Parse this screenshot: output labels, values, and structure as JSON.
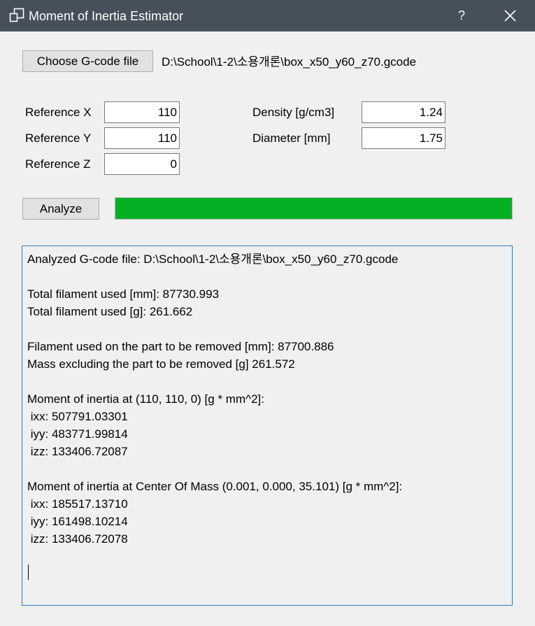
{
  "window": {
    "title": "Moment of Inertia Estimator",
    "help_label": "?",
    "icons": {
      "app": "window-icon",
      "close": "close-icon"
    }
  },
  "file": {
    "choose_label": "Choose G-code file",
    "path": "D:\\School\\1-2\\소용개론\\box_x50_y60_z70.gcode"
  },
  "params": {
    "ref_x": {
      "label": "Reference X",
      "value": "110"
    },
    "ref_y": {
      "label": "Reference Y",
      "value": "110"
    },
    "ref_z": {
      "label": "Reference Z",
      "value": "0"
    },
    "density": {
      "label": "Density [g/cm3]",
      "value": "1.24"
    },
    "diameter": {
      "label": "Diameter [mm]",
      "value": "1.75"
    }
  },
  "analyze": {
    "button_label": "Analyze",
    "progress": 1.0,
    "progress_color": "#06b025"
  },
  "output": {
    "lines": [
      "Analyzed G-code file: D:\\School\\1-2\\소용개론\\box_x50_y60_z70.gcode",
      "",
      "Total filament used [mm]: 87730.993",
      "Total filament used [g]: 261.662",
      "",
      "Filament used on the part to be removed [mm]: 87700.886",
      "Mass excluding the part to be removed [g] 261.572",
      "",
      "Moment of inertia at (110, 110, 0) [g * mm^2]:",
      " ixx: 507791.03301",
      " iyy: 483771.99814",
      " izz: 133406.72087",
      "",
      "Moment of inertia at Center Of Mass (0.001, 0.000, 35.101) [g * mm^2]:",
      " ixx: 185517.13710",
      " iyy: 161498.10214",
      " izz: 133406.72078"
    ]
  },
  "colors": {
    "titlebar": "#45505a",
    "background": "#f0f0f0",
    "output_border": "#2e7dc0"
  }
}
